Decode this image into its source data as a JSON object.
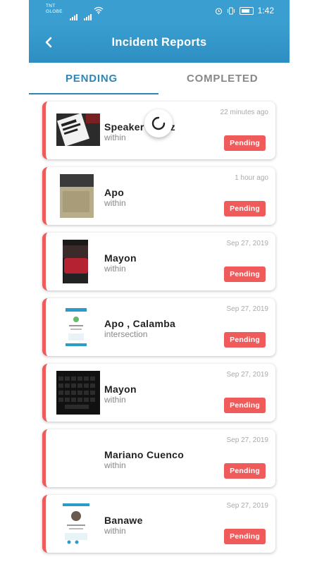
{
  "status_bar": {
    "carrier_line1": "TNT",
    "carrier_line2": "GLOBE",
    "time": "1:42"
  },
  "app_bar": {
    "title": "Incident Reports",
    "back_icon": "back-arrow-icon"
  },
  "tabs": [
    {
      "label": "PENDING",
      "active": true
    },
    {
      "label": "COMPLETED",
      "active": false
    }
  ],
  "reports": [
    {
      "place": "Speaker",
      "place_suffix": "z",
      "note": "within",
      "time": "22 minutes ago",
      "status": "Pending"
    },
    {
      "place": "Apo",
      "note": "within",
      "time": "1 hour ago",
      "status": "Pending"
    },
    {
      "place": "Mayon",
      "note": "within",
      "time": "Sep 27, 2019",
      "status": "Pending"
    },
    {
      "place": "Apo , Calamba",
      "note": "intersection",
      "time": "Sep 27, 2019",
      "status": "Pending"
    },
    {
      "place": "Mayon",
      "note": "within",
      "time": "Sep 27, 2019",
      "status": "Pending"
    },
    {
      "place": "Mariano Cuenco",
      "note": "within",
      "time": "Sep 27, 2019",
      "status": "Pending"
    },
    {
      "place": "Banawe",
      "note": "within",
      "time": "Sep 27, 2019",
      "status": "Pending"
    }
  ],
  "colors": {
    "primary": "#3a9fd0",
    "tab_active": "#2f86b6",
    "pending": "#ef5b5b"
  }
}
